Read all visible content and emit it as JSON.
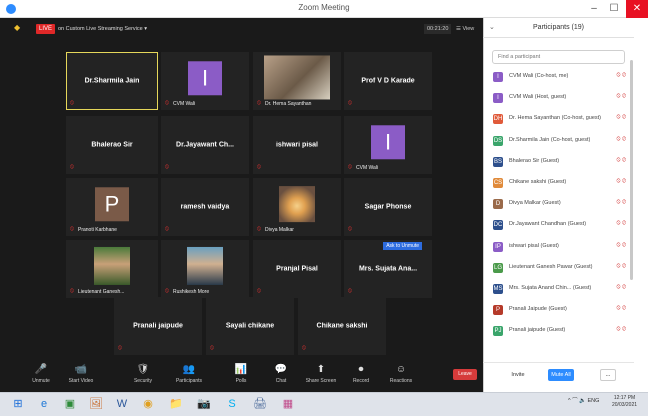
{
  "window": {
    "title": "Zoom Meeting",
    "min": "–",
    "max": "☐",
    "close": "✕"
  },
  "topbar": {
    "live": "LIVE",
    "stream": "on Custom Live Streaming Service ▾",
    "timer": "00:21:20",
    "view": "☰ View"
  },
  "tiles": [
    {
      "name": "Dr.Sharmila Jain",
      "label": "",
      "type": "name",
      "active": true
    },
    {
      "name": "",
      "label": "CVM Wali",
      "type": "avatar",
      "letter": "I",
      "color": "#8b5cc6"
    },
    {
      "name": "",
      "label": "Dr. Hema Sayanthan",
      "type": "photo"
    },
    {
      "name": "Prof V D Karade",
      "label": "",
      "type": "name"
    },
    {
      "name": "Bhalerao Sir",
      "label": "",
      "type": "name"
    },
    {
      "name": "Dr.Jayawant Ch...",
      "label": "",
      "type": "name"
    },
    {
      "name": "ishwari pisal",
      "label": "",
      "type": "name"
    },
    {
      "name": "",
      "label": "CVM Wali",
      "type": "avatar",
      "letter": "I",
      "color": "#8b5cc6"
    },
    {
      "name": "",
      "label": "Pranoti Karbhane",
      "type": "avatar",
      "letter": "P",
      "color": "#7a5a48"
    },
    {
      "name": "ramesh vaidya",
      "label": "",
      "type": "name"
    },
    {
      "name": "",
      "label": "Divya Malkar",
      "type": "sunset"
    },
    {
      "name": "Sagar Phonse",
      "label": "",
      "type": "name"
    },
    {
      "name": "",
      "label": "Lieutenant Ganesh...",
      "type": "photo2"
    },
    {
      "name": "",
      "label": "Rushikesh More",
      "type": "photo3"
    },
    {
      "name": "Pranjal Pisal",
      "label": "",
      "type": "name"
    },
    {
      "name": "Mrs. Sujata Ana...",
      "label": "",
      "type": "name",
      "ask": "Ask to Unmute"
    },
    {
      "name": "Pranali jaipude",
      "label": "",
      "type": "name"
    },
    {
      "name": "Sayali chikane",
      "label": "",
      "type": "name"
    },
    {
      "name": "Chikane sakshi",
      "label": "",
      "type": "name"
    }
  ],
  "toolbar": [
    {
      "icon": "🎤",
      "label": "Unmute"
    },
    {
      "icon": "📹",
      "label": "Start Video"
    },
    {
      "icon": "🛡",
      "label": "Security"
    },
    {
      "icon": "👥",
      "label": "Participants"
    },
    {
      "icon": "📊",
      "label": "Polls"
    },
    {
      "icon": "💬",
      "label": "Chat"
    },
    {
      "icon": "⬆",
      "label": "Share Screen"
    },
    {
      "icon": "⏺",
      "label": "Record"
    },
    {
      "icon": "☺",
      "label": "Reactions"
    }
  ],
  "leave": "Leave",
  "panel": {
    "title": "Participants (19)",
    "collapse": "⌄",
    "search_placeholder": "Find a participant",
    "invite": "Invite",
    "mute_all": "Mute All",
    "more": "...",
    "participants": [
      {
        "initial": "I",
        "color": "#8b5cc6",
        "name": "CVM Wali (Co-host, me)"
      },
      {
        "initial": "I",
        "color": "#8b5cc6",
        "name": "CVM Wali (Host, guest)"
      },
      {
        "initial": "DH",
        "color": "#e05a3a",
        "name": "Dr. Hema Sayanthan (Co-host, guest)"
      },
      {
        "initial": "DS",
        "color": "#3aa56b",
        "name": "Dr.Sharmila Jain (Co-host, guest)"
      },
      {
        "initial": "BS",
        "color": "#2d4f8c",
        "name": "Bhalerao Sir (Guest)"
      },
      {
        "initial": "CS",
        "color": "#e08a3a",
        "name": "Chikane sakshi (Guest)"
      },
      {
        "initial": "D",
        "color": "#9a6a4a",
        "name": "Divya Malkar (Guest)"
      },
      {
        "initial": "DC",
        "color": "#2d4f8c",
        "name": "Dr.Jayawant Chandhan (Guest)"
      },
      {
        "initial": "IP",
        "color": "#8b5cc6",
        "name": "ishwari pisal (Guest)"
      },
      {
        "initial": "LG",
        "color": "#4a9a4a",
        "name": "Lieutenant Ganesh Pawar (Guest)"
      },
      {
        "initial": "MS",
        "color": "#2d4f8c",
        "name": "Mrs. Sujata Anand Chin... (Guest)"
      },
      {
        "initial": "P",
        "color": "#b53a2a",
        "name": "Pranali Jaipude (Guest)"
      },
      {
        "initial": "PJ",
        "color": "#3aa56b",
        "name": "Pranali jaipude (Guest)"
      }
    ]
  },
  "taskbar": {
    "apps": [
      {
        "icon": "⊞",
        "color": "#1e6fd9"
      },
      {
        "icon": "e",
        "color": "#1e78d6"
      },
      {
        "icon": "▣",
        "color": "#2e8b3a"
      },
      {
        "icon": "🖼",
        "color": "#c86a2a"
      },
      {
        "icon": "W",
        "color": "#2b579a"
      },
      {
        "icon": "◉",
        "color": "#e0a020"
      },
      {
        "icon": "📁",
        "color": "#e0b030"
      },
      {
        "icon": "📷",
        "color": "#2d8cff"
      },
      {
        "icon": "S",
        "color": "#00aff0"
      },
      {
        "icon": "🖨",
        "color": "#4a6a9a"
      },
      {
        "icon": "▦",
        "color": "#c04a8a"
      }
    ],
    "tray": "^ ⌒ 🔈 ENG",
    "time": "12:17 PM",
    "date": "20/03/2021"
  }
}
